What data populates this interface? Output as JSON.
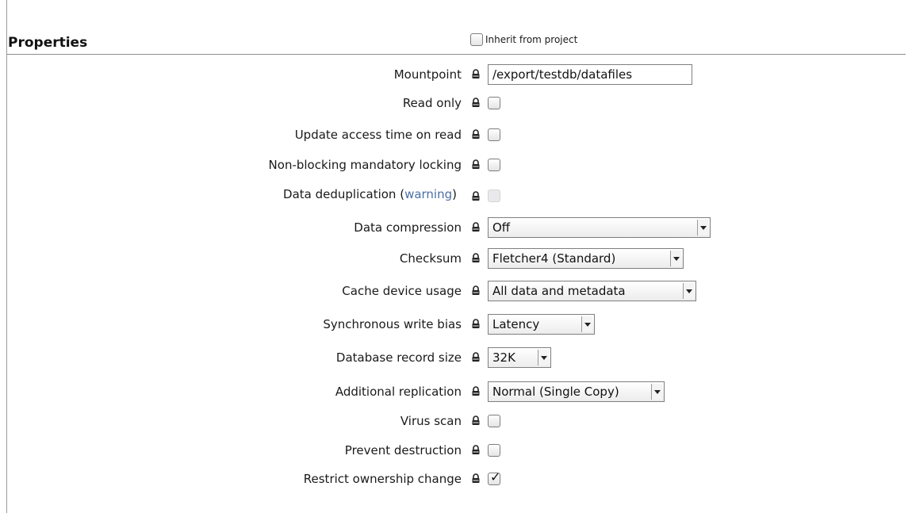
{
  "header": {
    "title": "Properties",
    "inherit_label": "Inherit from project",
    "inherit_checked": false
  },
  "fields": {
    "mountpoint": {
      "label": "Mountpoint",
      "value": "/export/testdb/datafiles"
    },
    "read_only": {
      "label": "Read only",
      "checked": false
    },
    "update_atime": {
      "label": "Update access time on read",
      "checked": false
    },
    "nbmand": {
      "label": "Non-blocking mandatory locking",
      "checked": false
    },
    "dedup": {
      "label": "Data deduplication (",
      "link": "warning",
      "label_end": ")",
      "checked": false,
      "disabled": true
    },
    "compression": {
      "label": "Data compression",
      "value": "Off"
    },
    "checksum": {
      "label": "Checksum",
      "value": "Fletcher4 (Standard)"
    },
    "cache_device": {
      "label": "Cache device usage",
      "value": "All data and metadata"
    },
    "sync_bias": {
      "label": "Synchronous write bias",
      "value": "Latency"
    },
    "record_size": {
      "label": "Database record size",
      "value": "32K"
    },
    "replication": {
      "label": "Additional replication",
      "value": "Normal (Single Copy)"
    },
    "virus_scan": {
      "label": "Virus scan",
      "checked": false
    },
    "prevent_destruction": {
      "label": "Prevent destruction",
      "checked": false
    },
    "restrict_ownership": {
      "label": "Restrict ownership change",
      "checked": true,
      "check_glyph": "✓"
    }
  },
  "icons": {
    "lock": "lock-icon",
    "dropdown": "chevron-down-icon"
  },
  "colors": {
    "link": "#4a6fa5",
    "rule": "#8c8c8c"
  }
}
